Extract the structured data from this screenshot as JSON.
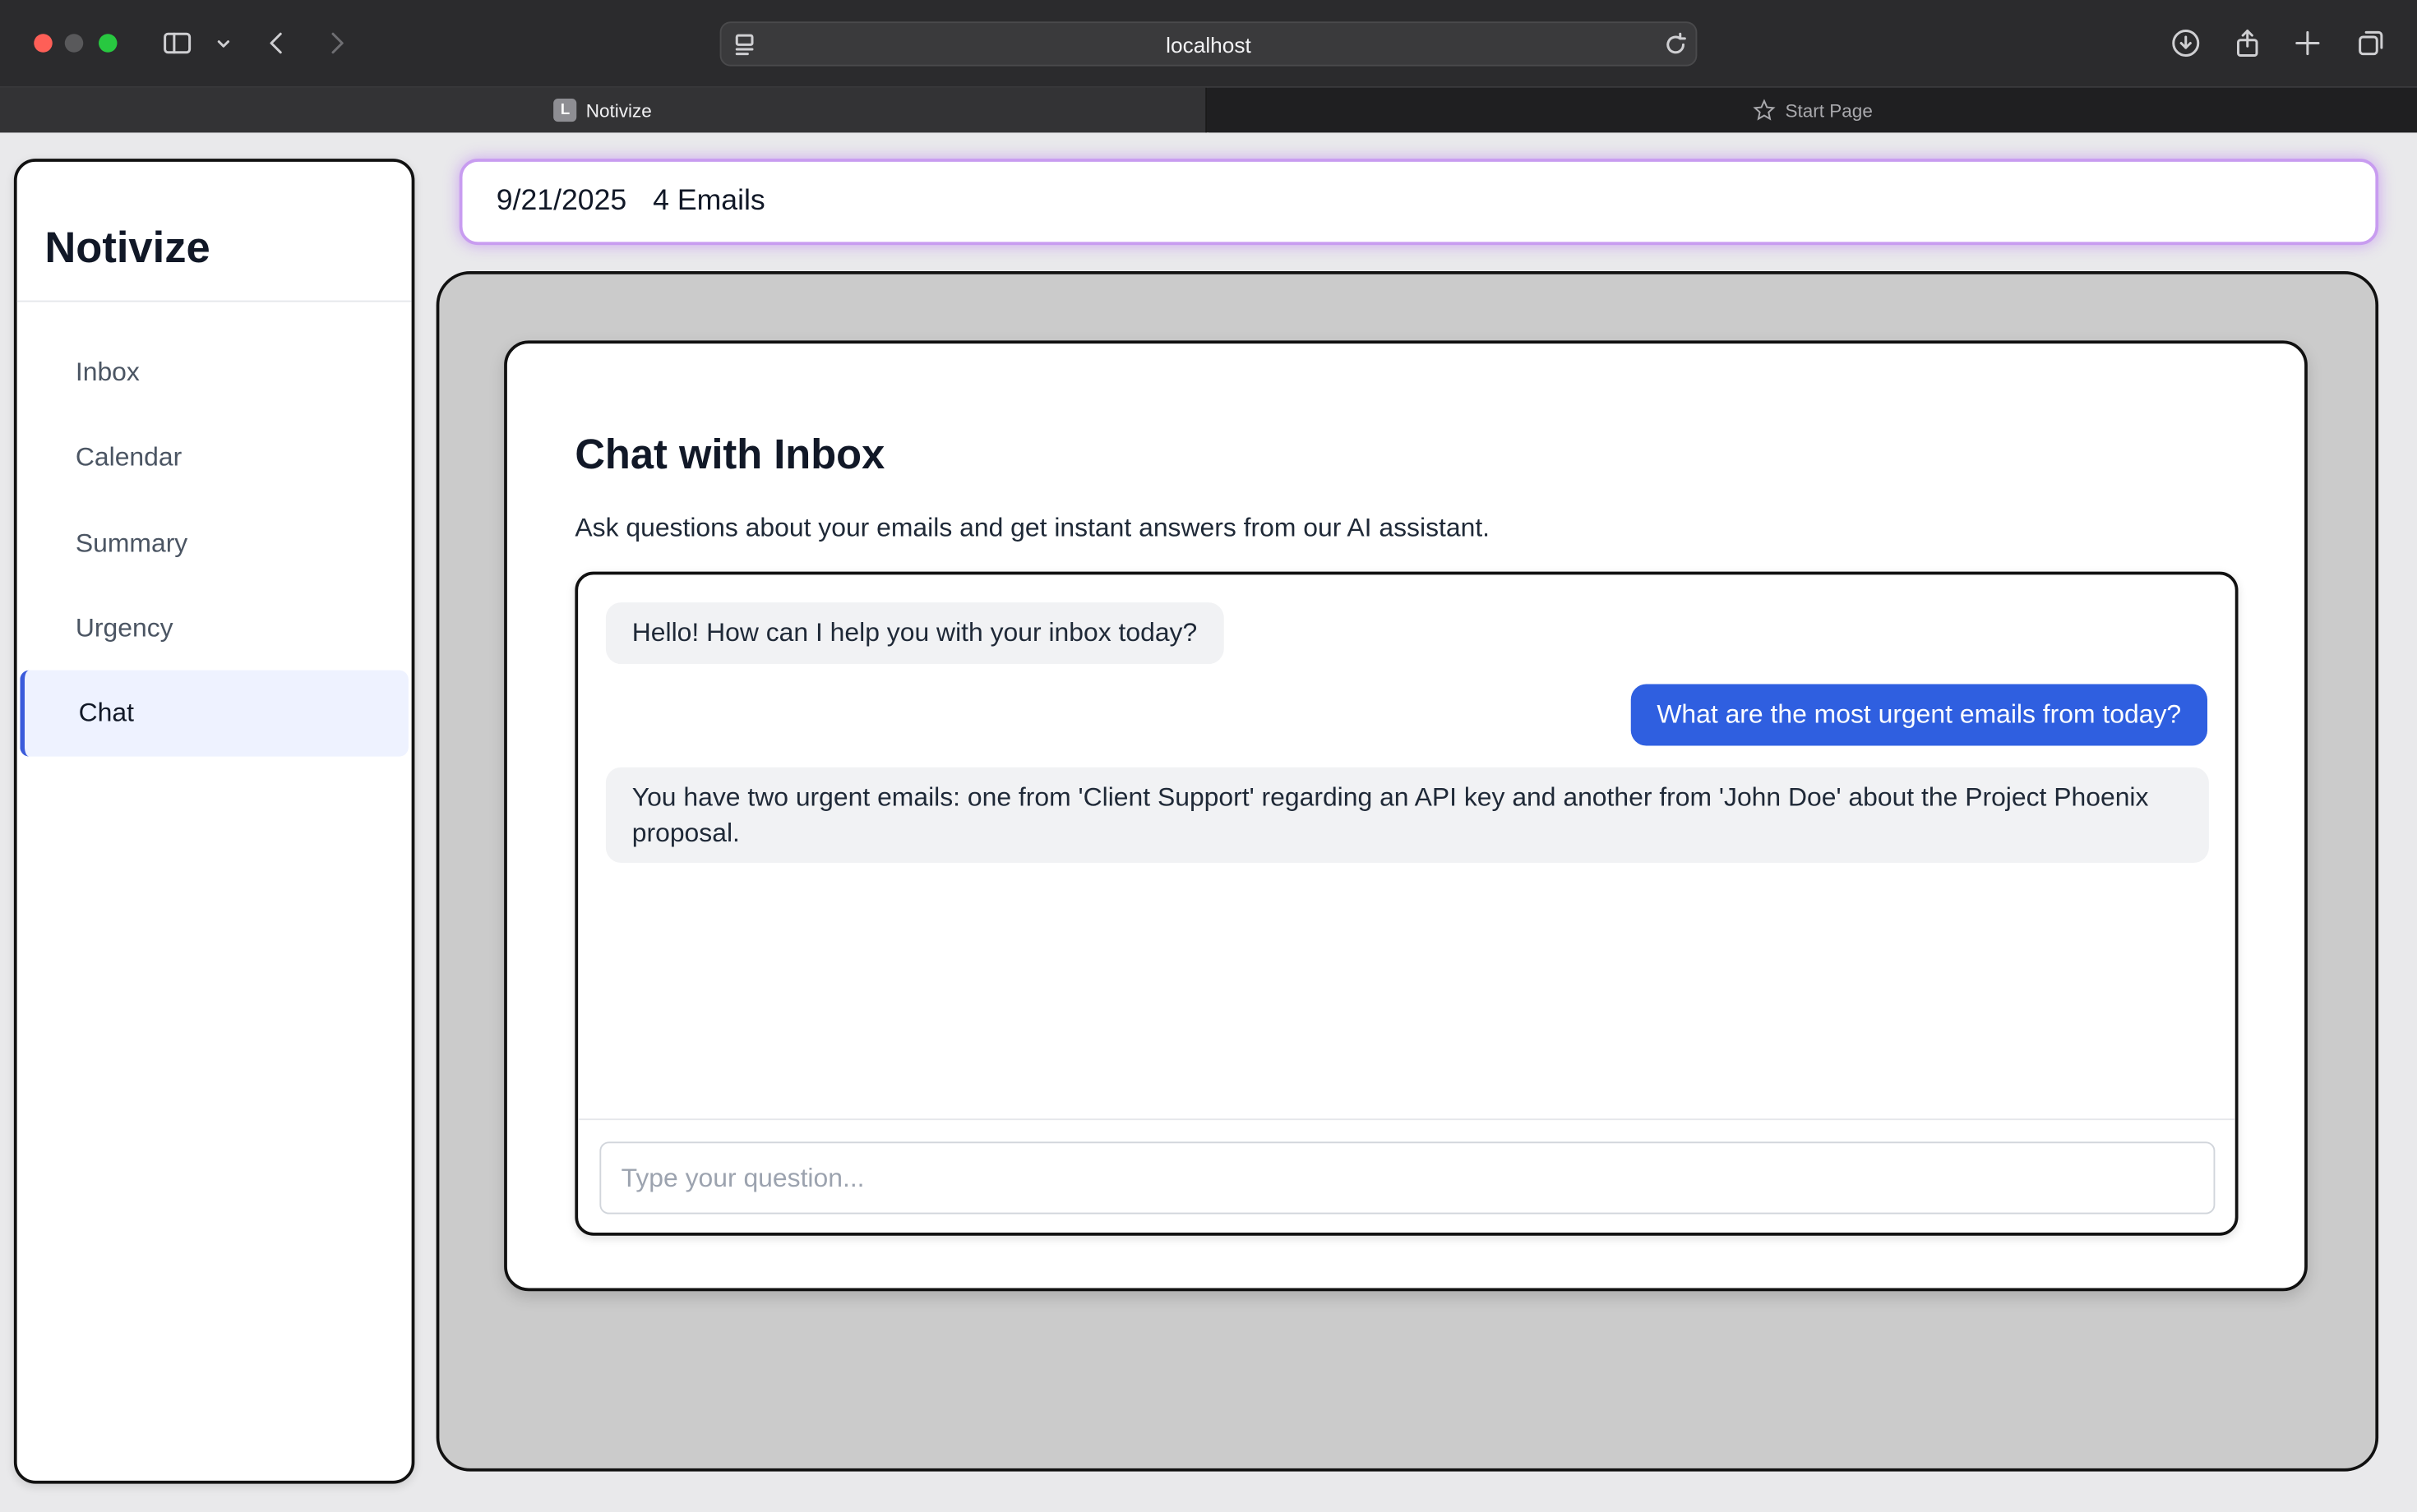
{
  "browser": {
    "address": "localhost",
    "tabs": [
      {
        "label": "Notivize",
        "favicon": "L",
        "active": true
      },
      {
        "label": "Start Page",
        "icon": "star-icon",
        "active": false
      }
    ]
  },
  "sidebar": {
    "brand": "Notivize",
    "items": [
      {
        "label": "Inbox"
      },
      {
        "label": "Calendar"
      },
      {
        "label": "Summary"
      },
      {
        "label": "Urgency"
      },
      {
        "label": "Chat",
        "active": true
      }
    ]
  },
  "header": {
    "date": "9/21/2025",
    "email_count": "4 Emails"
  },
  "chat": {
    "title": "Chat with Inbox",
    "description": "Ask questions about your emails and get instant answers from our AI assistant.",
    "messages": [
      {
        "role": "assistant",
        "text": "Hello! How can I help you with your inbox today?"
      },
      {
        "role": "user",
        "text": "What are the most urgent emails from today?"
      },
      {
        "role": "assistant",
        "text": "You have two urgent emails: one from 'Client Support' regarding an API key and another from 'John Doe' about the Project Phoenix proposal."
      }
    ],
    "input_placeholder": "Type your question..."
  },
  "colors": {
    "accent": "#2f5fe0",
    "header_glow": "#c89cf0",
    "active_nav_bg": "#eef2ff"
  }
}
